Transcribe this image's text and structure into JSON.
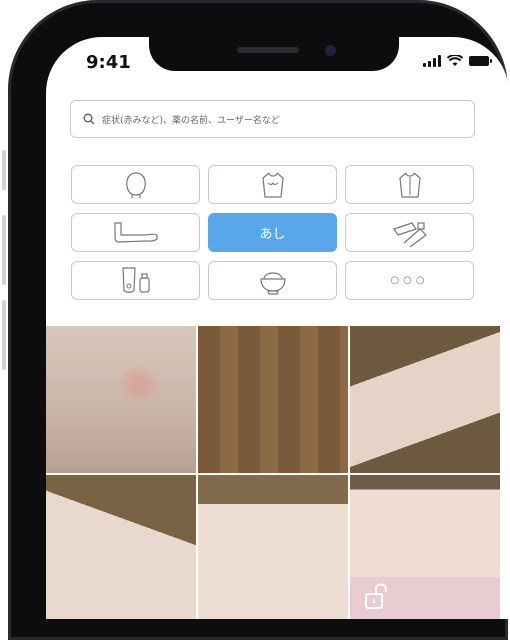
{
  "status_bar": {
    "time": "9:41"
  },
  "search": {
    "placeholder": "症状(赤みなど)、薬の名前、ユーザー名など"
  },
  "categories": [
    {
      "id": "head",
      "icon": "head-icon"
    },
    {
      "id": "chest",
      "icon": "torso-front-icon"
    },
    {
      "id": "back",
      "icon": "torso-back-icon"
    },
    {
      "id": "arm",
      "icon": "arm-icon"
    },
    {
      "id": "leg",
      "label": "あし",
      "active": true
    },
    {
      "id": "medicine",
      "icon": "ointment-tube-icon"
    },
    {
      "id": "cosmetics",
      "icon": "cosmetics-bottles-icon"
    },
    {
      "id": "food",
      "icon": "rice-bowl-icon"
    },
    {
      "id": "more",
      "label": "○○○"
    }
  ],
  "photos": [
    {
      "id": "photo-1"
    },
    {
      "id": "photo-2"
    },
    {
      "id": "photo-3"
    },
    {
      "id": "photo-4"
    },
    {
      "id": "photo-5"
    },
    {
      "id": "photo-6",
      "badge": "unlock-icon"
    }
  ],
  "colors": {
    "accent": "#5aa6ea",
    "border": "#c6cacf"
  }
}
